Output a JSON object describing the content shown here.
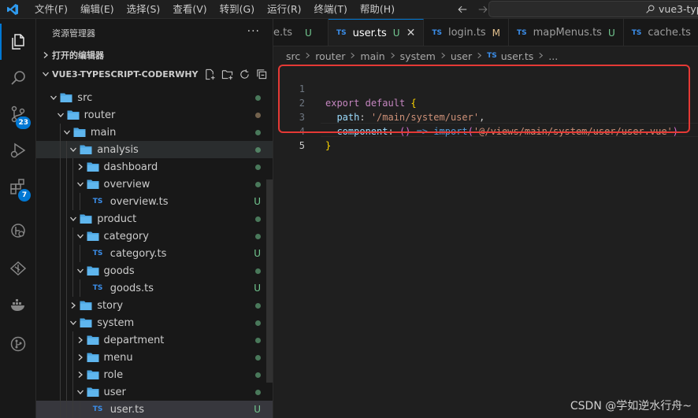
{
  "menu": [
    "文件(F)",
    "编辑(E)",
    "选择(S)",
    "查看(V)",
    "转到(G)",
    "运行(R)",
    "终端(T)",
    "帮助(H)"
  ],
  "command_center": {
    "text": "vue3-typ"
  },
  "activity_bar": {
    "badges": {
      "source_control": "23",
      "extensions": "7"
    }
  },
  "sidebar": {
    "title": "资源管理器",
    "more": "···",
    "open_editors": "打开的编辑器",
    "project": "VUE3-TYPESCRIPT-CODERWHY",
    "tree": [
      {
        "label": "src",
        "kind": "folder",
        "open": true,
        "depth": 1,
        "status": "dot"
      },
      {
        "label": "router",
        "kind": "folder",
        "open": true,
        "depth": 2,
        "status": "dot-brown"
      },
      {
        "label": "main",
        "kind": "folder",
        "open": true,
        "depth": 3,
        "status": "dot"
      },
      {
        "label": "analysis",
        "kind": "folder",
        "open": true,
        "depth": 4,
        "status": "dot",
        "hl": true
      },
      {
        "label": "dashboard",
        "kind": "folder",
        "open": false,
        "depth": 5,
        "status": "dot"
      },
      {
        "label": "overview",
        "kind": "folder",
        "open": true,
        "depth": 5,
        "status": "dot"
      },
      {
        "label": "overview.ts",
        "kind": "ts",
        "depth": 6,
        "status": "U"
      },
      {
        "label": "product",
        "kind": "folder",
        "open": true,
        "depth": 4,
        "status": "dot"
      },
      {
        "label": "category",
        "kind": "folder",
        "open": true,
        "depth": 5,
        "status": "dot"
      },
      {
        "label": "category.ts",
        "kind": "ts",
        "depth": 6,
        "status": "U"
      },
      {
        "label": "goods",
        "kind": "folder",
        "open": true,
        "depth": 5,
        "status": "dot"
      },
      {
        "label": "goods.ts",
        "kind": "ts",
        "depth": 6,
        "status": "U"
      },
      {
        "label": "story",
        "kind": "folder",
        "open": false,
        "depth": 4,
        "status": "dot"
      },
      {
        "label": "system",
        "kind": "folder",
        "open": true,
        "depth": 4,
        "status": "dot"
      },
      {
        "label": "department",
        "kind": "folder",
        "open": false,
        "depth": 5,
        "status": "dot"
      },
      {
        "label": "menu",
        "kind": "folder",
        "open": false,
        "depth": 5,
        "status": "dot"
      },
      {
        "label": "role",
        "kind": "folder",
        "open": false,
        "depth": 5,
        "status": "dot"
      },
      {
        "label": "user",
        "kind": "folder",
        "open": true,
        "depth": 5,
        "status": "dot"
      },
      {
        "label": "user.ts",
        "kind": "ts",
        "depth": 6,
        "status": "U",
        "sel": true
      }
    ]
  },
  "tabs": [
    {
      "label": "e.ts",
      "mark": "U",
      "markType": "u",
      "partial": true
    },
    {
      "label": "user.ts",
      "mark": "U",
      "markType": "u",
      "active": true,
      "close": "✕"
    },
    {
      "label": "login.ts",
      "mark": "M",
      "markType": "m"
    },
    {
      "label": "mapMenus.ts",
      "mark": "U",
      "markType": "u"
    },
    {
      "label": "cache.ts",
      "mark": "",
      "markType": ""
    }
  ],
  "ts_label": "TS",
  "breadcrumb": [
    "src",
    "router",
    "main",
    "system",
    "user",
    "user.ts",
    "..."
  ],
  "code": {
    "line_numbers": [
      "1",
      "2",
      "3",
      "4",
      "5"
    ],
    "l1": {
      "kw1": "export",
      "kw2": "default",
      "brace": "{"
    },
    "l2": {
      "prop": "path",
      "colon": ": ",
      "str": "'/main/system/user'",
      "comma": ","
    },
    "l3": {
      "prop": "component",
      "colon": ": ",
      "paren": "()",
      "arrow": "=>",
      "fn": "import",
      "open": "(",
      "str": "'@/views/main/system/user/user.vue'",
      "close": ")"
    },
    "l4": {
      "brace": "}"
    }
  },
  "watermark": "CSDN @学如逆水行舟~",
  "colors": {
    "accent": "#0078d4",
    "highlight_box": "#e53935",
    "untracked": "#73c991",
    "modified": "#e2c08d"
  }
}
